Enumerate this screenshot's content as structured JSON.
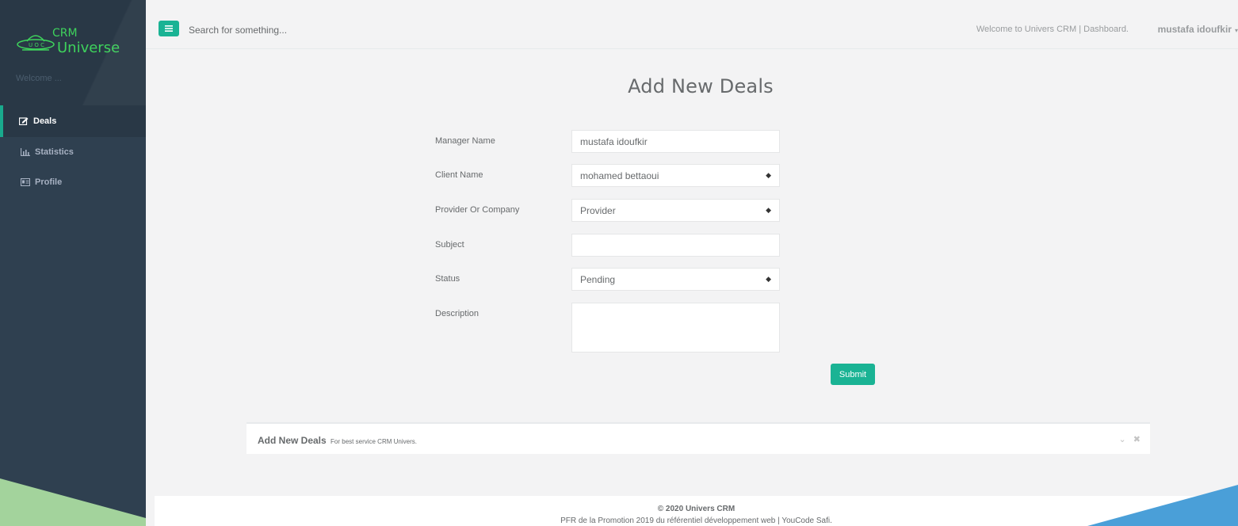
{
  "brand": {
    "line1": "CRM",
    "line2": "Universe",
    "accent": "#3ed25c"
  },
  "sidebar": {
    "welcome": "Welcome ...",
    "items": [
      {
        "label": "Deals",
        "icon": "edit-icon",
        "active": true
      },
      {
        "label": "Statistics",
        "icon": "bar-chart-icon",
        "active": false
      },
      {
        "label": "Profile",
        "icon": "id-card-icon",
        "active": false
      }
    ]
  },
  "topbar": {
    "search_placeholder": "Search for something...",
    "welcome_message": "Welcome to Univers CRM | Dashboard.",
    "user_name": "mustafa idoufkir"
  },
  "page": {
    "title": "Add New Deals"
  },
  "form": {
    "manager_label": "Manager Name",
    "manager_value": "mustafa idoufkir",
    "client_label": "Client Name",
    "client_value": "mohamed bettaoui",
    "provider_label": "Provider Or Company",
    "provider_value": "Provider",
    "subject_label": "Subject",
    "subject_value": "",
    "status_label": "Status",
    "status_value": "Pending",
    "description_label": "Description",
    "description_value": "",
    "submit_label": "Submit"
  },
  "ibox": {
    "title": "Add New Deals",
    "subtitle": "For best service CRM Univers."
  },
  "footer": {
    "copyright": "© 2020 Univers CRM",
    "subtitle": "PFR de la Promotion 2019 du référentiel développement web | YouCode Safi."
  },
  "colors": {
    "sidebar": "#2f4050",
    "primary": "#1ab394",
    "background": "#f3f3f4"
  }
}
